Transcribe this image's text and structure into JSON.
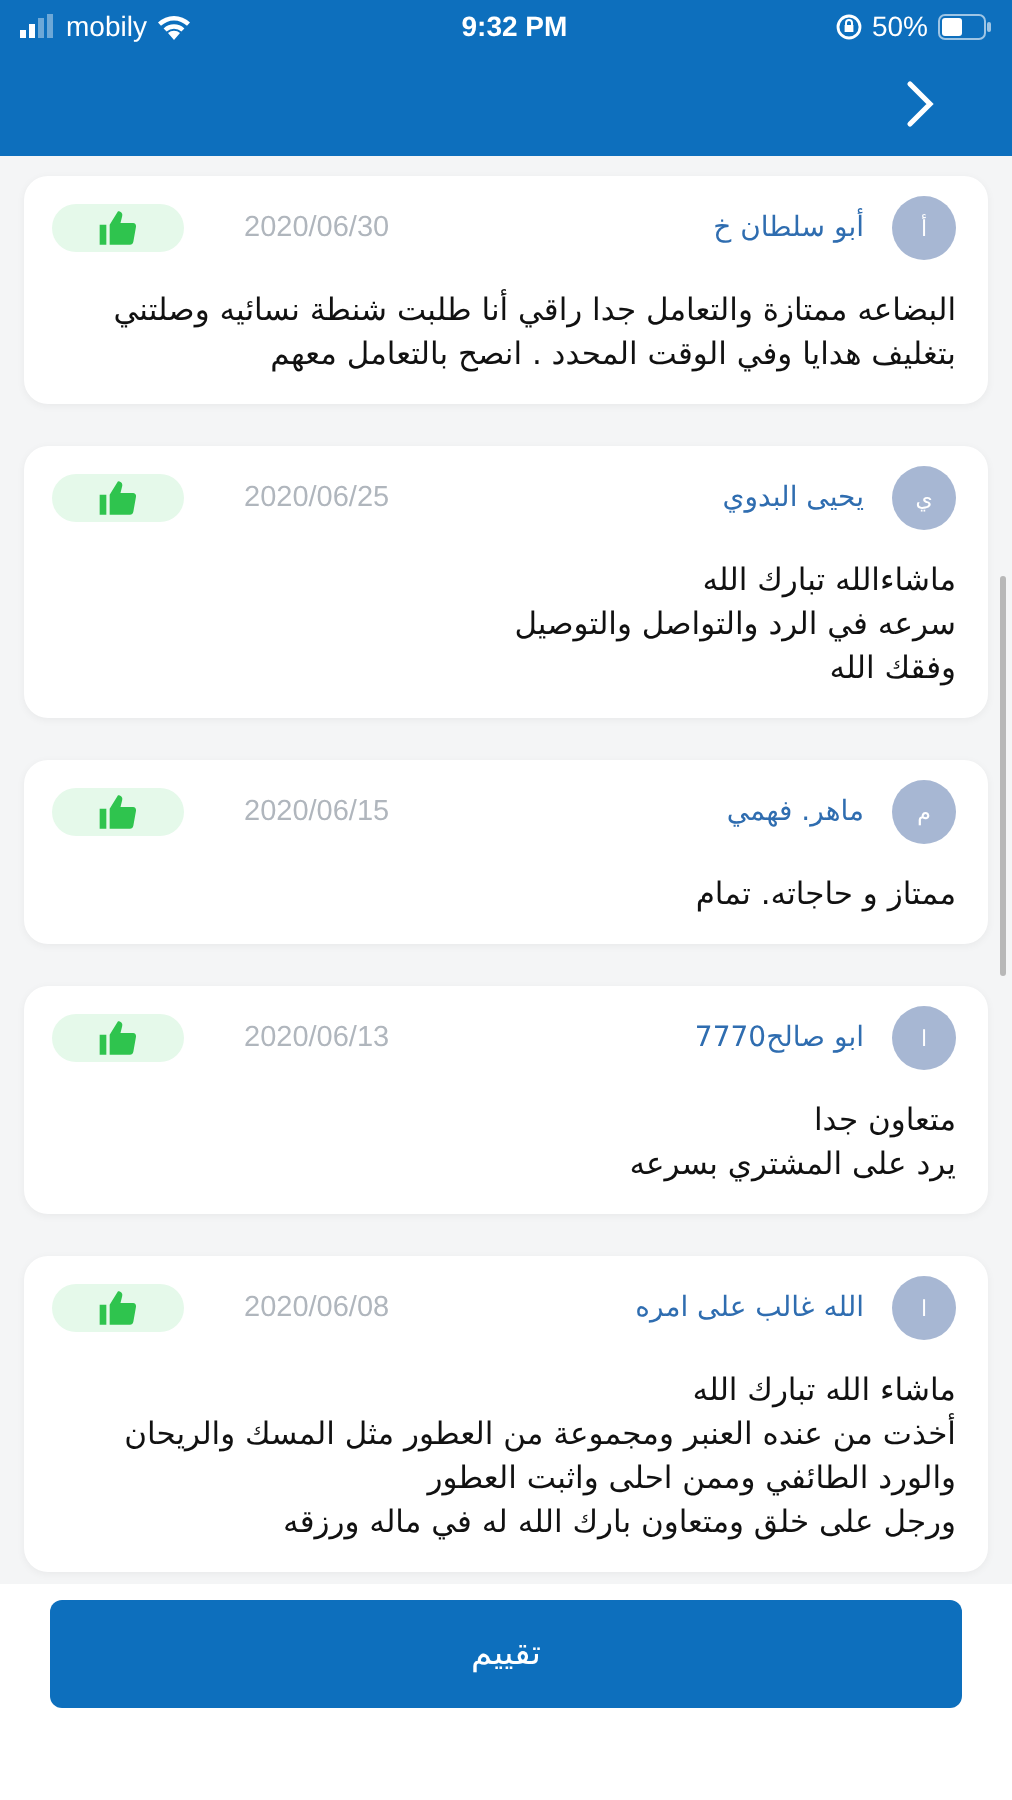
{
  "status_bar": {
    "carrier": "mobily",
    "time": "9:32 PM",
    "battery": "50%"
  },
  "reviews": [
    {
      "initial": "أ",
      "name": "أبو سلطان خ",
      "date": "2020/06/30",
      "positive": true,
      "text": "البضاعه ممتازة والتعامل  جدا راقي أنا طلبت شنطة نسائيه وصلتني بتغليف هدايا وفي الوقت المحدد . انصح بالتعامل معهم"
    },
    {
      "initial": "ي",
      "name": "يحيى البدوي",
      "date": "2020/06/25",
      "positive": true,
      "text": "ماشاءالله تبارك الله\nسرعه في الرد والتواصل والتوصيل\nوفقك الله"
    },
    {
      "initial": "م",
      "name": "ماهر. فهمي",
      "date": "2020/06/15",
      "positive": true,
      "text": "ممتاز  و حاجاته. تمام"
    },
    {
      "initial": "ا",
      "name": "ابو صالح7770",
      "date": "2020/06/13",
      "positive": true,
      "text": "متعاون جدا\nيرد على المشتري بسرعه"
    },
    {
      "initial": "ا",
      "name": "الله غالب على امره",
      "date": "2020/06/08",
      "positive": true,
      "text": "ماشاء الله تبارك الله\nأخذت من عنده العنبر ومجموعة من العطور مثل المسك والريحان\nوالورد الطائفي  وممن احلى واثبت العطور\nورجل على خلق ومتعاون بارك الله له في ماله ورزقه"
    }
  ],
  "rate_button": "تقييم"
}
